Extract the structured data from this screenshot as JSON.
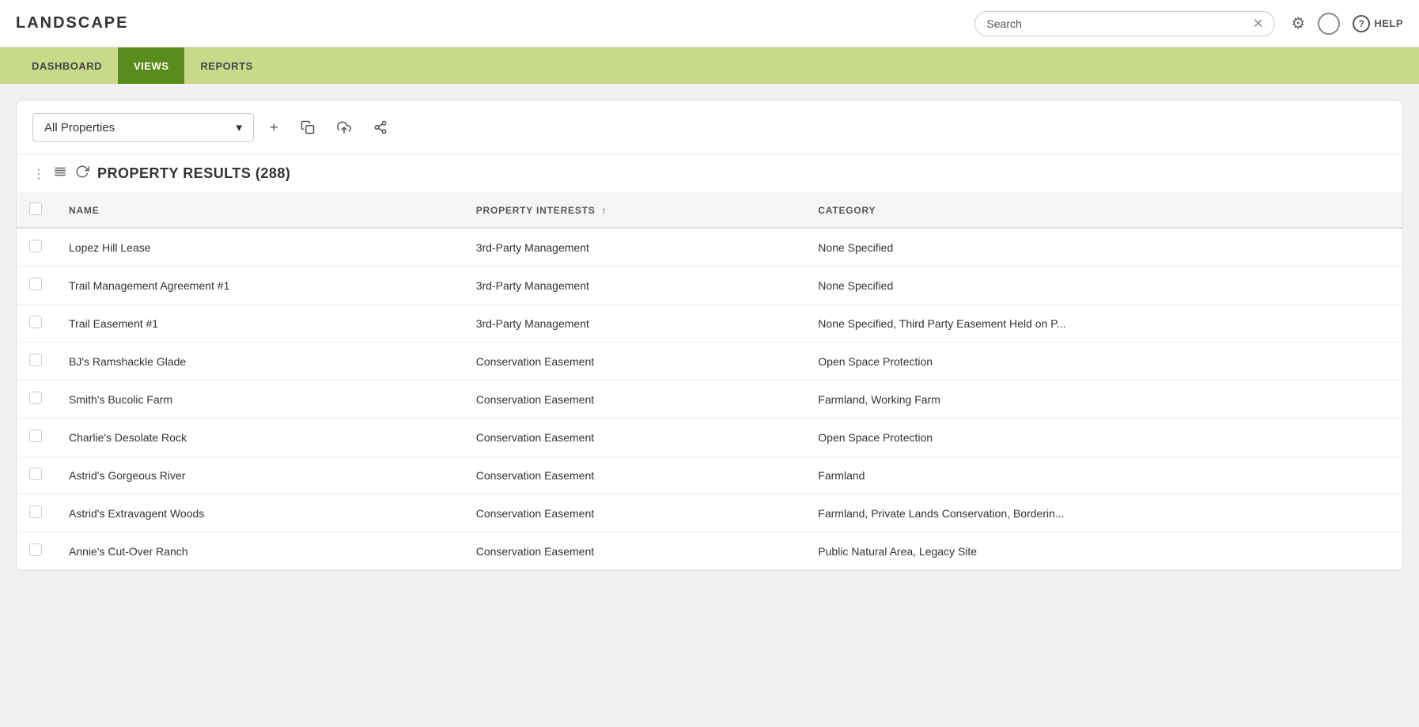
{
  "app": {
    "logo": "LANDSCAPE"
  },
  "header": {
    "search_placeholder": "Search",
    "search_value": "Search",
    "help_label": "HELP"
  },
  "nav": {
    "items": [
      {
        "label": "DASHBOARD",
        "active": false
      },
      {
        "label": "VIEWS",
        "active": true
      },
      {
        "label": "REPORTS",
        "active": false
      }
    ]
  },
  "toolbar": {
    "view_label": "All Properties",
    "add_icon": "+",
    "copy_icon": "⧉",
    "upload_icon": "⬆",
    "share_icon": "⑂"
  },
  "results": {
    "title": "PROPERTY RESULTS",
    "count": "(288)"
  },
  "table": {
    "columns": [
      {
        "label": "",
        "key": "checkbox"
      },
      {
        "label": "NAME",
        "key": "name",
        "sortable": false
      },
      {
        "label": "PROPERTY INTERESTS",
        "key": "interests",
        "sortable": true
      },
      {
        "label": "CATEGORY",
        "key": "category",
        "sortable": false
      }
    ],
    "rows": [
      {
        "name": "Lopez Hill Lease",
        "interests": "3rd-Party Management",
        "category": "None Specified"
      },
      {
        "name": "Trail Management Agreement #1",
        "interests": "3rd-Party Management",
        "category": "None Specified"
      },
      {
        "name": "Trail Easement #1",
        "interests": "3rd-Party Management",
        "category": "None Specified, Third Party Easement Held on P..."
      },
      {
        "name": "BJ's Ramshackle Glade",
        "interests": "Conservation Easement",
        "category": "Open Space Protection"
      },
      {
        "name": "Smith's Bucolic Farm",
        "interests": "Conservation Easement",
        "category": "Farmland, Working Farm"
      },
      {
        "name": "Charlie's Desolate Rock",
        "interests": "Conservation Easement",
        "category": "Open Space Protection"
      },
      {
        "name": "Astrid's Gorgeous River",
        "interests": "Conservation Easement",
        "category": "Farmland"
      },
      {
        "name": "Astrid's Extravagent Woods",
        "interests": "Conservation Easement",
        "category": "Farmland, Private Lands Conservation, Borderin..."
      },
      {
        "name": "Annie's Cut-Over Ranch",
        "interests": "Conservation Easement",
        "category": "Public Natural Area, Legacy Site"
      }
    ]
  },
  "icons": {
    "chevron_down": "▾",
    "dots_vertical": "⋮",
    "columns_icon": "☰",
    "refresh_icon": "↻",
    "clear_icon": "✕",
    "gear_icon": "⚙",
    "user_icon": "○",
    "help_circle": "?",
    "sort_up": "↑"
  },
  "colors": {
    "nav_active": "#5a8c1c",
    "nav_bg": "#c8d98a",
    "accent": "#5a8c1c"
  }
}
